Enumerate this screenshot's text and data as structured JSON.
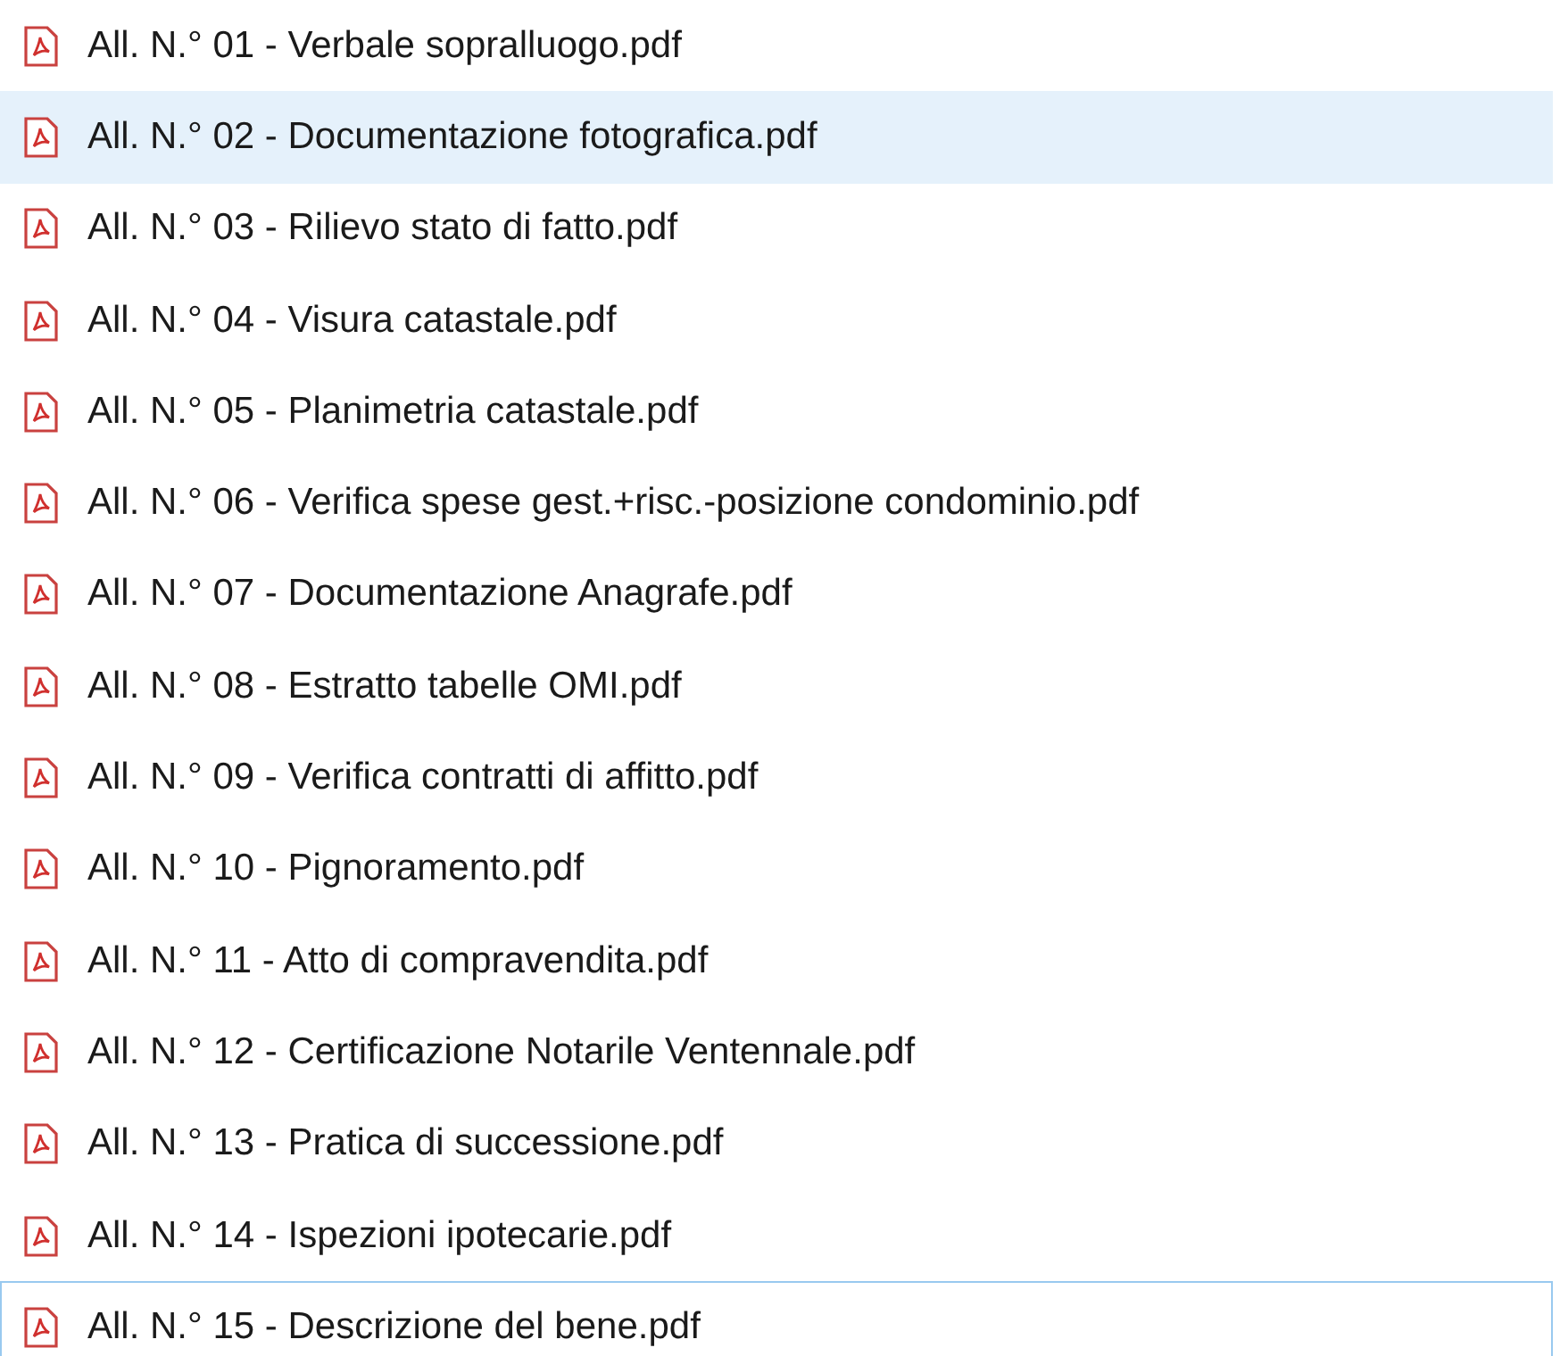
{
  "files": [
    {
      "name": "All. N.° 01 - Verbale sopralluogo.pdf",
      "hovered": false,
      "focused": false
    },
    {
      "name": "All. N.° 02 - Documentazione fotografica.pdf",
      "hovered": true,
      "focused": false
    },
    {
      "name": "All. N.° 03 - Rilievo stato di fatto.pdf",
      "hovered": false,
      "focused": false
    },
    {
      "name": "All. N.° 04 - Visura catastale.pdf",
      "hovered": false,
      "focused": false
    },
    {
      "name": "All. N.° 05 - Planimetria catastale.pdf",
      "hovered": false,
      "focused": false
    },
    {
      "name": "All. N.° 06 - Verifica spese gest.+risc.-posizione condominio.pdf",
      "hovered": false,
      "focused": false
    },
    {
      "name": "All. N.° 07 - Documentazione Anagrafe.pdf",
      "hovered": false,
      "focused": false
    },
    {
      "name": "All. N.° 08 - Estratto tabelle OMI.pdf",
      "hovered": false,
      "focused": false
    },
    {
      "name": "All. N.° 09 - Verifica contratti di affitto.pdf",
      "hovered": false,
      "focused": false
    },
    {
      "name": "All. N.° 10 - Pignoramento.pdf",
      "hovered": false,
      "focused": false
    },
    {
      "name": "All. N.° 11 - Atto di compravendita.pdf",
      "hovered": false,
      "focused": false
    },
    {
      "name": "All. N.° 12 - Certificazione Notarile Ventennale.pdf",
      "hovered": false,
      "focused": false
    },
    {
      "name": "All. N.° 13 - Pratica di successione.pdf",
      "hovered": false,
      "focused": false
    },
    {
      "name": "All. N.° 14 - Ispezioni ipotecarie.pdf",
      "hovered": false,
      "focused": false
    },
    {
      "name": "All. N.° 15 - Descrizione del bene.pdf",
      "hovered": false,
      "focused": true
    }
  ]
}
